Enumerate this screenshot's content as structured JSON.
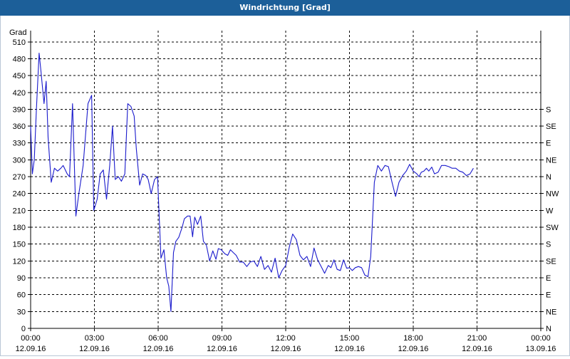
{
  "window": {
    "title": "Windrichtung [Grad]"
  },
  "colors": {
    "titlebar": "#1c5f99",
    "line": "#1a1acc",
    "grid": "#000000"
  },
  "chart_data": {
    "type": "line",
    "title": "Windrichtung [Grad]",
    "ylabel": "Grad",
    "ylim": [
      0,
      530
    ],
    "yticks": [
      0,
      30,
      60,
      90,
      120,
      150,
      180,
      210,
      240,
      270,
      300,
      330,
      360,
      390,
      420,
      450,
      480,
      510
    ],
    "right_axis_labels": [
      {
        "value": 0,
        "label": "N"
      },
      {
        "value": 30,
        "label": "NE"
      },
      {
        "value": 60,
        "label": "E"
      },
      {
        "value": 90,
        "label": "E"
      },
      {
        "value": 120,
        "label": "SE"
      },
      {
        "value": 150,
        "label": "S"
      },
      {
        "value": 180,
        "label": "SW"
      },
      {
        "value": 210,
        "label": "W"
      },
      {
        "value": 240,
        "label": "NW"
      },
      {
        "value": 270,
        "label": "N"
      },
      {
        "value": 300,
        "label": "NE"
      },
      {
        "value": 330,
        "label": "E"
      },
      {
        "value": 360,
        "label": "SE"
      },
      {
        "value": 390,
        "label": "S"
      }
    ],
    "xlim_hours": [
      0,
      24
    ],
    "xticks": [
      {
        "h": 0,
        "time": "00:00",
        "date": "12.09.16"
      },
      {
        "h": 3,
        "time": "03:00",
        "date": "12.09.16"
      },
      {
        "h": 6,
        "time": "06:00",
        "date": "12.09.16"
      },
      {
        "h": 9,
        "time": "09:00",
        "date": "12.09.16"
      },
      {
        "h": 12,
        "time": "12:00",
        "date": "12.09.16"
      },
      {
        "h": 15,
        "time": "15:00",
        "date": "12.09.16"
      },
      {
        "h": 18,
        "time": "18:00",
        "date": "12.09.16"
      },
      {
        "h": 21,
        "time": "21:00",
        "date": "12.09.16"
      },
      {
        "h": 24,
        "time": "00:00",
        "date": "13.09.16"
      }
    ],
    "grid": true,
    "series": [
      {
        "x_hours": [
          0.0,
          0.08,
          0.17,
          0.27,
          0.4,
          0.48,
          0.63,
          0.73,
          0.82,
          0.97,
          1.12,
          1.27,
          1.42,
          1.53,
          1.72,
          1.83,
          1.97,
          2.13,
          2.27,
          2.47,
          2.7,
          2.87,
          2.97,
          3.13,
          3.27,
          3.42,
          3.57,
          3.72,
          3.85,
          3.98,
          4.13,
          4.27,
          4.43,
          4.57,
          4.72,
          4.87,
          4.97,
          5.13,
          5.27,
          5.42,
          5.53,
          5.67,
          5.83,
          5.97,
          6.13,
          6.27,
          6.4,
          6.5,
          6.6,
          6.72,
          6.83,
          6.97,
          7.13,
          7.23,
          7.38,
          7.5,
          7.62,
          7.72,
          7.85,
          8.0,
          8.13,
          8.27,
          8.42,
          8.57,
          8.72,
          8.83,
          8.97,
          9.13,
          9.27,
          9.4,
          9.53,
          9.67,
          9.83,
          10.0,
          10.17,
          10.33,
          10.5,
          10.67,
          10.83,
          11.0,
          11.17,
          11.33,
          11.5,
          11.67,
          11.83,
          12.0,
          12.17,
          12.33,
          12.5,
          12.67,
          12.83,
          13.0,
          13.17,
          13.33,
          13.5,
          13.67,
          13.83,
          14.0,
          14.13,
          14.27,
          14.42,
          14.57,
          14.72,
          14.87,
          15.0,
          15.13,
          15.27,
          15.42,
          15.57,
          15.72,
          15.87,
          16.0,
          16.17,
          16.33,
          16.5,
          16.67,
          16.83,
          17.0,
          17.17,
          17.33,
          17.5,
          17.67,
          17.83,
          18.0,
          18.17,
          18.27,
          18.38,
          18.5,
          18.62,
          18.73,
          18.87,
          19.0,
          19.17,
          19.33,
          19.5,
          19.67,
          19.83,
          20.0,
          20.17,
          20.33,
          20.5,
          20.67,
          20.83,
          21.0,
          21.17,
          21.33,
          21.5,
          21.67,
          21.83,
          22.0,
          22.17,
          22.33,
          22.5,
          22.67,
          22.83,
          23.0,
          23.17,
          23.33,
          23.5,
          23.67,
          23.83,
          24.0
        ],
        "values": [
          360,
          275,
          300,
          390,
          490,
          460,
          400,
          440,
          340,
          260,
          285,
          280,
          285,
          290,
          275,
          270,
          400,
          200,
          240,
          290,
          400,
          415,
          210,
          230,
          275,
          282,
          230,
          290,
          360,
          265,
          270,
          262,
          275,
          400,
          395,
          378,
          320,
          255,
          275,
          272,
          265,
          240,
          265,
          270,
          125,
          140,
          90,
          75,
          30,
          135,
          155,
          162,
          180,
          195,
          200,
          200,
          163,
          198,
          185,
          200,
          155,
          148,
          120,
          138,
          123,
          142,
          140,
          133,
          130,
          140,
          135,
          130,
          118,
          118,
          110,
          118,
          120,
          110,
          128,
          105,
          112,
          100,
          125,
          90,
          103,
          112,
          145,
          168,
          158,
          130,
          122,
          128,
          110,
          143,
          122,
          110,
          98,
          112,
          108,
          122,
          105,
          103,
          122,
          107,
          108,
          103,
          108,
          110,
          108,
          95,
          92,
          128,
          260,
          290,
          280,
          290,
          288,
          260,
          235,
          260,
          272,
          280,
          292,
          280,
          275,
          270,
          278,
          280,
          285,
          280,
          287,
          275,
          278,
          290,
          290,
          288,
          285,
          285,
          280,
          278,
          272,
          275,
          285
        ]
      }
    ]
  }
}
